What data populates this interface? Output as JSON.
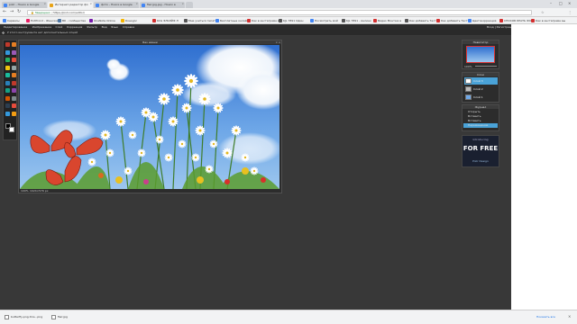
{
  "browser": {
    "tabs": [
      {
        "label": "pixlr - Поиск в Google",
        "color": "#4285f4",
        "active": false
      },
      {
        "label": "Интернет-редактор фо",
        "color": "#e8a317",
        "active": true
      },
      {
        "label": "фото - Поиск в Google",
        "color": "#4285f4",
        "active": false
      },
      {
        "label": "flwr.jpg.jpg - Поиск в",
        "color": "#4285f4",
        "active": false
      }
    ],
    "url": "https://pixlr.com/editor/",
    "url_prefix": "Защищено",
    "bookmarks": [
      {
        "label": "Сервисы",
        "color": "#4285f4"
      },
      {
        "label": "Hotlfrond - Женский",
        "color": "#e91e63"
      },
      {
        "label": "ВК - сообщества",
        "color": "#4c75a3"
      },
      {
        "label": "OneNote Online",
        "color": "#7719aa"
      },
      {
        "label": "Конкурс",
        "color": "#f4b400"
      },
      {
        "label": "KCG ЭЛЬЭЙФ Л",
        "color": "#d32f2f"
      },
      {
        "label": "Мне учиться писать",
        "color": "#555555"
      },
      {
        "label": "Бесплатные онлайн",
        "color": "#4285f4"
      },
      {
        "label": "Как в инстаграме вы",
        "color": "#d32f2f"
      },
      {
        "label": "KJL 7891 Один",
        "color": "#555555"
      },
      {
        "label": "Посмотреть мой",
        "color": "#4285f4"
      },
      {
        "label": "KJL 7891 - Анлинк",
        "color": "#555555"
      },
      {
        "label": "Видео Монтаж в",
        "color": "#d32f2f"
      },
      {
        "label": "Как добавить Тест",
        "color": "#555555"
      },
      {
        "label": "Как добавить Тест",
        "color": "#d32f2f"
      },
      {
        "label": "Цветокоррекция",
        "color": "#4285f4"
      },
      {
        "label": "СПОСОБ КРАТЬ ФОТ",
        "color": "#d32f2f"
      },
      {
        "label": "Как в инстаграме вы",
        "color": "#d32f2f"
      }
    ]
  },
  "editor": {
    "menu": [
      "Редактирование",
      "Изображение",
      "Слой",
      "Коррекция",
      "Фильтр",
      "Вид",
      "Язык",
      "Справка"
    ],
    "menu_right": "Вход | Регистрация",
    "options_text": "У этого инструмента нет дополнительных опций",
    "canvas": {
      "title": "Без имени",
      "status": "100%",
      "status_size": "1024×576 px"
    },
    "tool_colors": [
      "#c0392b",
      "#e67e22",
      "#3498db",
      "#9b59b6",
      "#27ae60",
      "#e74c3c",
      "#f1c40f",
      "#95a5a6",
      "#1abc9c",
      "#e67e22",
      "#2980b9",
      "#c0392b",
      "#16a085",
      "#8e44ad",
      "#d35400",
      "#7f8c8d",
      "#2c3e50",
      "#e74c3c",
      "#3498db",
      "#f39c12"
    ],
    "navigator": {
      "title": "Навигатор",
      "zoom": "100%"
    },
    "layers": {
      "title": "Слои",
      "items": [
        {
          "label": "Слой 3",
          "active": true
        },
        {
          "label": "Слой 2",
          "active": false
        },
        {
          "label": "Слой 1",
          "active": false
        }
      ]
    },
    "history": {
      "title": "Журнал",
      "items": [
        "Открыть",
        "Вставить",
        "Вставить",
        "Перемещение"
      ]
    },
    "ad": {
      "line1": "Introducing",
      "line2": "FOR FREE",
      "line3": "Pixlr Design"
    }
  },
  "downloads": {
    "items": [
      "butterfly-png-trns...png",
      "flwr.jpg"
    ],
    "show_all": "Показать все"
  }
}
